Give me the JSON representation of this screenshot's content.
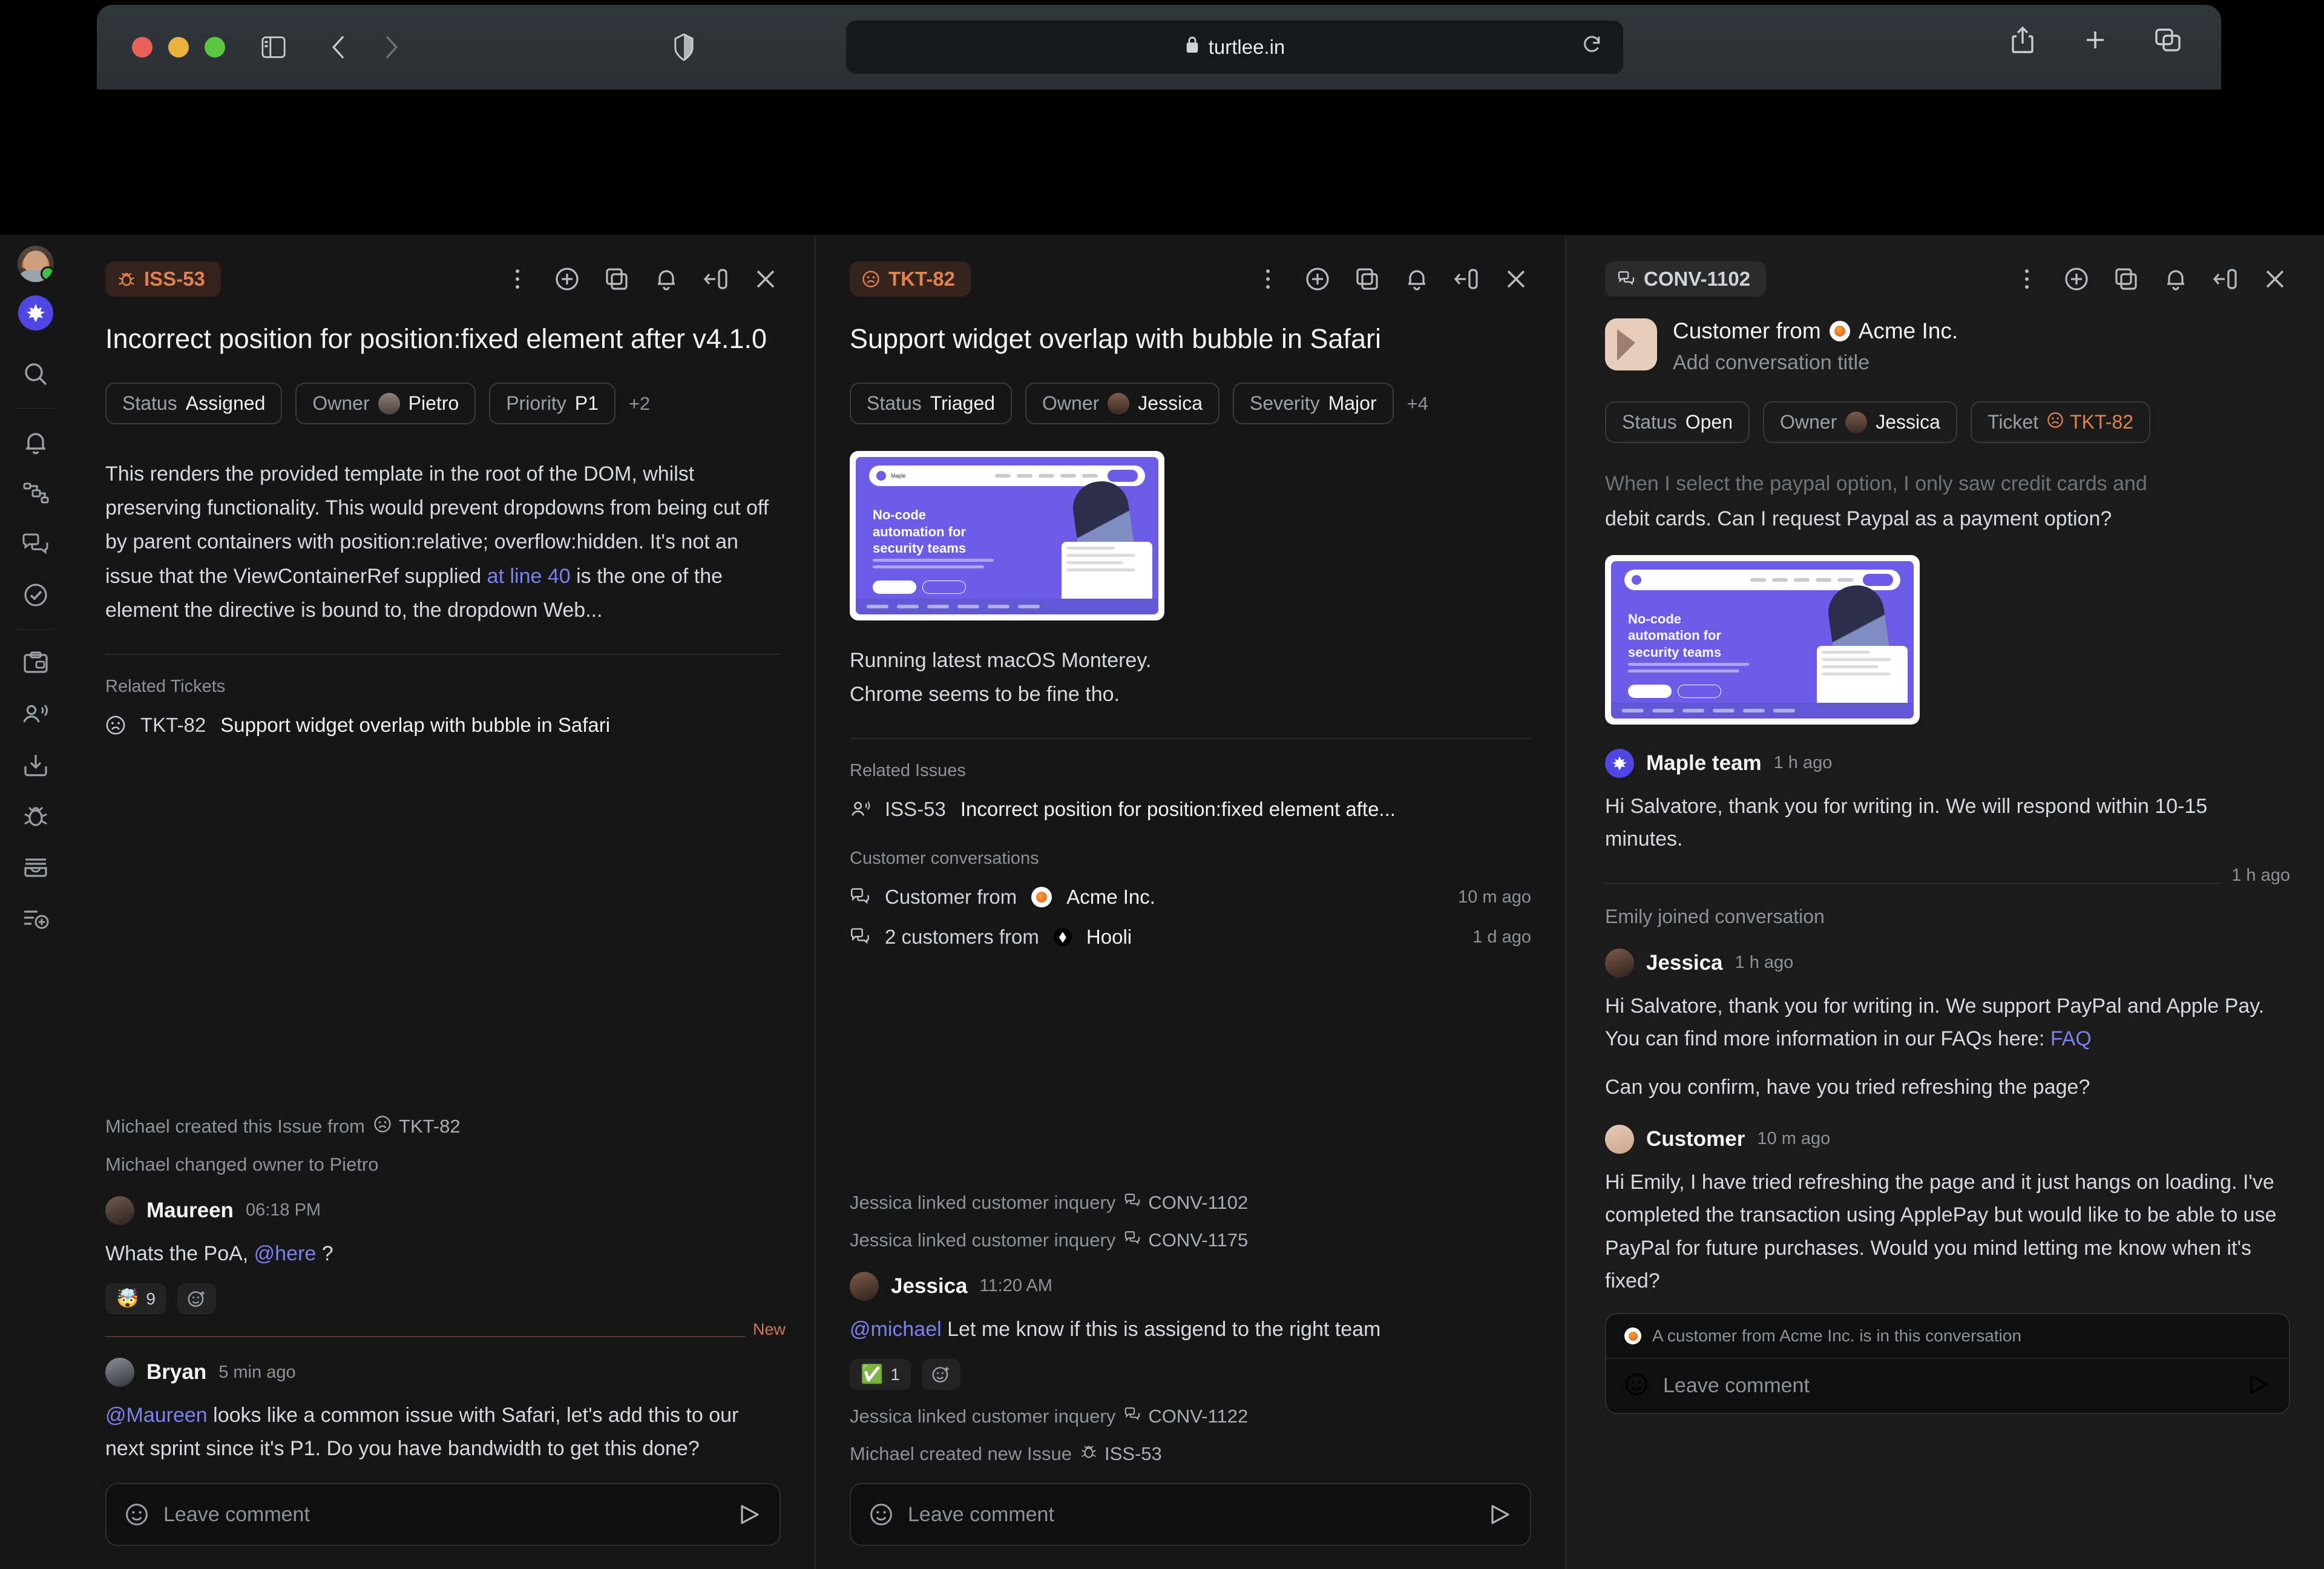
{
  "browser": {
    "url": "turtlee.in",
    "lock_icon": "lock-icon",
    "reload_icon": "reload-icon",
    "sidebar_toggle_icon": "sidebar-toggle-icon",
    "back_icon": "chevron-left-icon",
    "forward_icon": "chevron-right-icon",
    "shield_icon": "shield-icon",
    "share_icon": "share-icon",
    "new_tab_icon": "plus-icon",
    "tabs_icon": "tab-overview-icon"
  },
  "rail": {
    "items": [
      {
        "name": "user-avatar",
        "icon": "avatar"
      },
      {
        "name": "team-maple",
        "icon": "maple-leaf-icon"
      },
      {
        "name": "search",
        "icon": "search-icon"
      },
      {
        "name": "notifications",
        "icon": "bell-icon"
      },
      {
        "name": "projects",
        "icon": "flow-icon"
      },
      {
        "name": "conversations",
        "icon": "chat-icon"
      },
      {
        "name": "tasks",
        "icon": "check-circle-icon"
      },
      {
        "name": "clipboard",
        "icon": "clipboard-icon"
      },
      {
        "name": "customers",
        "icon": "customer-icon"
      },
      {
        "name": "inbox",
        "icon": "inbox-download-icon"
      },
      {
        "name": "issues",
        "icon": "bug-icon"
      },
      {
        "name": "archive",
        "icon": "archive-icon"
      },
      {
        "name": "add-list",
        "icon": "list-add-icon"
      }
    ]
  },
  "panels": {
    "issue": {
      "badge": "ISS-53",
      "badge_icon": "bug-icon",
      "title": "Incorrect position for position:fixed element after v4.1.0",
      "actions": [
        "more-icon",
        "add-icon",
        "copy-icon",
        "bell-icon",
        "collapse-icon",
        "close-icon"
      ],
      "chips": [
        {
          "key": "Status",
          "value": "Assigned"
        },
        {
          "key": "Owner",
          "value": "Pietro",
          "avatar": "pietro"
        },
        {
          "key": "Priority",
          "value": "P1"
        }
      ],
      "chips_more": "+2",
      "description": {
        "p1": "This renders the provided template in the root of the DOM, whilst preserving functionality. This would prevent dropdowns from being cut off by parent containers with position:relative; overflow:hidden. It's not an issue that the ViewContainerRef supplied ",
        "link": "at line 40",
        "p2": " is the one of the element the directive is bound to, the dropdown Web..."
      },
      "related_label": "Related Tickets",
      "related": [
        {
          "icon": "ticket-sad-icon",
          "id": "TKT-82",
          "title": "Support widget overlap with bubble in Safari"
        }
      ],
      "events": [
        {
          "text_before": "Michael created this Issue from ",
          "icon": "ticket-sad-icon",
          "id": "TKT-82"
        },
        {
          "text_before": "Michael changed owner to Pietro",
          "icon": "",
          "id": ""
        }
      ],
      "comments": [
        {
          "author": "Maureen",
          "avatar": "maureen",
          "time": "06:18 PM",
          "text_before": "Whats the PoA, ",
          "mention": "@here",
          "text_after": " ?",
          "reactions": [
            {
              "emoji": "🤯",
              "count": "9"
            }
          ],
          "add_reaction_icon": "add-reaction-icon"
        },
        {
          "author": "Bryan",
          "avatar": "bryan",
          "time": "5 min ago",
          "mention": "@Maureen",
          "text_after": " looks like a common issue with Safari, let's add this to our next sprint since it's P1. Do you have bandwidth to get this done?",
          "reactions": [],
          "add_reaction_icon": ""
        }
      ],
      "new_divider_label": "New",
      "composer_placeholder": "Leave comment",
      "composer_emoji_icon": "emoji-icon",
      "composer_send_icon": "send-icon"
    },
    "ticket": {
      "badge": "TKT-82",
      "badge_icon": "ticket-sad-icon",
      "title": "Support widget overlap with bubble in Safari",
      "actions": [
        "more-icon",
        "add-icon",
        "copy-icon",
        "bell-icon",
        "collapse-icon",
        "close-icon"
      ],
      "chips": [
        {
          "key": "Status",
          "value": "Triaged"
        },
        {
          "key": "Owner",
          "value": "Jessica",
          "avatar": "jessica"
        },
        {
          "key": "Severity",
          "value": "Major"
        }
      ],
      "chips_more": "+4",
      "attachment": {
        "name": "maple-landing-screenshot",
        "headline_l1": "No-code",
        "headline_l2": "automation for",
        "headline_l3": "security teams",
        "brand": "Maple"
      },
      "body": "Running latest macOS Monterey.\nChrome seems to be fine tho.",
      "related_issues_label": "Related Issues",
      "related_issues": [
        {
          "icon": "issue-icon",
          "id": "ISS-53",
          "title": "Incorrect position for position:fixed element afte..."
        }
      ],
      "customer_conv_label": "Customer conversations",
      "customer_conversations": [
        {
          "icon": "chat-icon",
          "text": "Customer from",
          "org": "Acme Inc.",
          "org_logo": "acme",
          "time": "10 m ago"
        },
        {
          "icon": "chat-icon",
          "text": "2 customers from",
          "org": "Hooli",
          "org_logo": "hooli",
          "time": "1 d ago"
        }
      ],
      "events_top": [
        {
          "text": "Jessica linked customer inquery",
          "icon": "chat-icon",
          "id": "CONV-1102"
        },
        {
          "text": "Jessica linked customer inquery",
          "icon": "chat-icon",
          "id": "CONV-1175"
        }
      ],
      "comments": [
        {
          "author": "Jessica",
          "avatar": "jessica",
          "time": "11:20 AM",
          "mention": "@michael",
          "text_after": " Let me know if this is assigend to the right team",
          "reactions": [
            {
              "emoji": "✅",
              "count": "1"
            }
          ],
          "add_reaction_icon": "add-reaction-icon"
        }
      ],
      "events_bottom": [
        {
          "text": "Jessica linked customer inquery",
          "icon": "chat-icon",
          "id": "CONV-1122"
        },
        {
          "text": "Michael created new Issue",
          "icon": "bug-icon",
          "id": "ISS-53"
        }
      ],
      "composer_placeholder": "Leave comment",
      "composer_emoji_icon": "emoji-icon",
      "composer_send_icon": "send-icon"
    },
    "conversation": {
      "badge": "CONV-1102",
      "badge_icon": "chat-icon",
      "actions": [
        "more-icon",
        "add-icon",
        "copy-icon",
        "bell-icon",
        "collapse-icon",
        "close-icon"
      ],
      "header_title_prefix": "Customer from",
      "header_org": "Acme Inc.",
      "header_subtitle": "Add conversation title",
      "chips": [
        {
          "key": "Status",
          "value": "Open"
        },
        {
          "key": "Owner",
          "value": "Jessica",
          "avatar": "jessica"
        },
        {
          "key": "Ticket",
          "value": "TKT-82",
          "ticket": true
        }
      ],
      "cut_message_top": "When I select the paypal option, I only saw credit cards and",
      "cut_message_rest": "debit cards. Can I request Paypal as a payment option?",
      "attachment": {
        "name": "maple-landing-screenshot",
        "headline_l1": "No-code",
        "headline_l2": "automation for",
        "headline_l3": "security teams"
      },
      "messages": [
        {
          "author": "Maple team",
          "avatar": "maple",
          "time": "1 h ago",
          "text": "Hi Salvatore, thank you for writing in. We will respond within 10-15 minutes."
        },
        {
          "author": "Jessica",
          "avatar": "jessica",
          "time": "1 h ago",
          "text_before": "Hi Salvatore, thank you for writing in. We support PayPal and Apple Pay. You can find more information in our FAQs here: ",
          "link": "FAQ",
          "text_after2": "Can you confirm, have you tried refreshing the page?"
        },
        {
          "author": "Customer",
          "avatar": "customer",
          "time": "10 m ago",
          "text": "Hi Emily, I have tried refreshing the page and it just hangs on loading. I've completed the transaction using ApplePay but would like to be able to use PayPal for future purchases. Would you mind letting me know when it's fixed?"
        }
      ],
      "divider_time": "1 h ago",
      "joined_text": "Emily joined conversation",
      "composer_note": "A customer from Acme Inc. is in this conversation",
      "composer_placeholder": "Leave comment",
      "composer_emoji_icon": "emoji-icon",
      "composer_send_icon": "send-icon"
    }
  },
  "colors": {
    "accent_orange": "#e08250",
    "accent_purple": "#7b82f0",
    "brand_purple": "#4f46e5",
    "panel_bg": "#161616",
    "panel_bg_alt": "#1b1b1b"
  }
}
